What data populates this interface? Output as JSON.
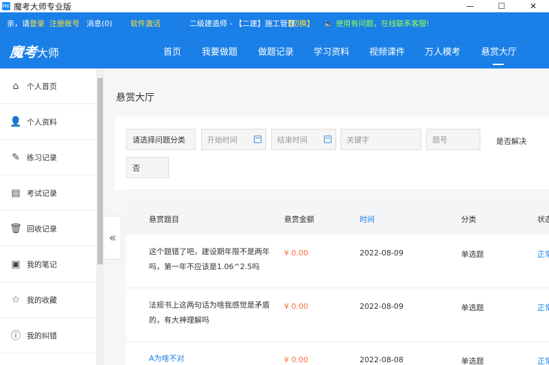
{
  "window": {
    "title": "魔考大师专业版",
    "icon_text": "MK",
    "controls": [
      "—",
      "☐",
      "✕"
    ]
  },
  "infobar": {
    "greeting": "亲，请",
    "login": "登录",
    "register": "注册账号",
    "messages": "消息(0)",
    "activate": "软件激活",
    "exam": "二级建造师 - 【二建】施工管理",
    "switch": "【切换】",
    "help": "使用有问题，在线联系客服!"
  },
  "nav": {
    "logo_main": "魔考",
    "logo_sub": "大师",
    "items": [
      "首页",
      "我要做题",
      "做题记录",
      "学习资料",
      "视频课件",
      "万人模考",
      "悬赏大厅"
    ],
    "active_index": 6
  },
  "sidebar": {
    "items": [
      {
        "label": "个人首页",
        "icon": "home-icon"
      },
      {
        "label": "个人资料",
        "icon": "user-icon"
      },
      {
        "label": "练习记录",
        "icon": "edit-icon"
      },
      {
        "label": "考试记录",
        "icon": "document-icon"
      },
      {
        "label": "回收记录",
        "icon": "trash-icon"
      },
      {
        "label": "我的笔记",
        "icon": "note-icon"
      },
      {
        "label": "我的收藏",
        "icon": "star-icon"
      },
      {
        "label": "我的纠错",
        "icon": "alert-icon"
      }
    ],
    "collapse_glyph": "«"
  },
  "page": {
    "title": "悬赏大厅"
  },
  "filters": {
    "category": "请选择问题分类",
    "start_time": "开始时间",
    "end_time": "结束时间",
    "keyword": "关键字",
    "question_no": "题号",
    "resolved_label": "是否解决",
    "resolved_value": "否"
  },
  "table": {
    "headers": [
      "悬赏题目",
      "悬赏金额",
      "时间",
      "分类",
      "状态"
    ],
    "rows": [
      {
        "title": "这个题错了吧，建设期年限不是两年吗，第一年不应该是1.06^2.5吗",
        "amount": "¥ 0.00",
        "date": "2022-08-09",
        "category": "单选题",
        "status": "正常"
      },
      {
        "title": "法规书上这两句话为啥我感觉是矛盾的，有大神理解吗",
        "amount": "¥ 0.00",
        "date": "2022-08-09",
        "category": "单选题",
        "status": "正常"
      },
      {
        "title": "A为啥不对",
        "amount": "¥ 0.00",
        "date": "2022-08-08",
        "category": "单选题",
        "status": "正常"
      }
    ]
  },
  "colors": {
    "brand_blue": "#1a7fe6",
    "money": "#ff6a3d",
    "highlight_yellow": "#ffe23d",
    "highlight_green": "#9dff4f"
  }
}
